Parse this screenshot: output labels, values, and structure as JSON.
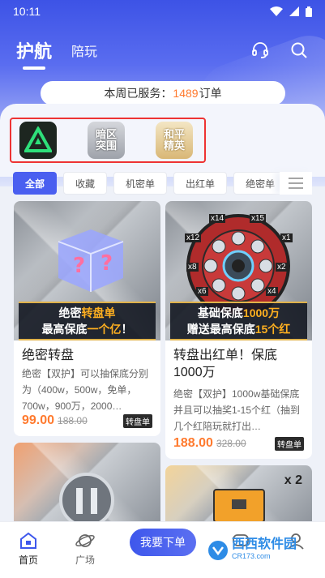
{
  "status": {
    "time": "10:11"
  },
  "nav": {
    "tab_main": "护航",
    "tab_sub": "陪玩"
  },
  "service": {
    "prefix": "本周已服务：",
    "count": "1489",
    "suffix": "订单"
  },
  "games": [
    {
      "name": "三角洲行动"
    },
    {
      "name": "暗区突围"
    },
    {
      "name": "和平精英"
    }
  ],
  "categories": [
    "全部",
    "收藏",
    "机密单",
    "出红单",
    "绝密单"
  ],
  "cards": {
    "c1": {
      "banner_line1_pre": "绝密",
      "banner_line1_hl": "转盘单",
      "banner_line2_pre": "最高保底",
      "banner_line2_hl": "一个亿",
      "banner_line2_post": "！",
      "title": "绝密转盘",
      "desc": "绝密【双护】可以抽保底分别为（400w，500w，免单，700w，900万，2000…",
      "price": "99.00",
      "orig": "188.00",
      "tag": "转盘单"
    },
    "c2": {
      "banner_line1_pre": "基础保底",
      "banner_line1_hl": "1000万",
      "banner_line2_pre": "赠送最高保底",
      "banner_line2_hl": "15个红",
      "wheel_labels": [
        "x14",
        "x15",
        "x12",
        "x1",
        "x8",
        "x2",
        "x6",
        "x4"
      ],
      "title": "转盘出红单！保底1000万",
      "desc": "绝密【双护】1000w基础保底并且可以抽奖1-15个红（抽到几个红陪玩就打出…",
      "price": "188.00",
      "orig": "328.00",
      "tag": "转盘单"
    },
    "c4": {
      "badge": "x 2"
    }
  },
  "bottom": {
    "home": "首页",
    "square": "广场",
    "cta": "我要下单"
  },
  "watermark": {
    "text": "西西软件园",
    "sub": "CR173.com"
  },
  "colors": {
    "accent": "#4a5ff0",
    "price": "#ff7a2e",
    "highlight_border": "#e33333"
  }
}
